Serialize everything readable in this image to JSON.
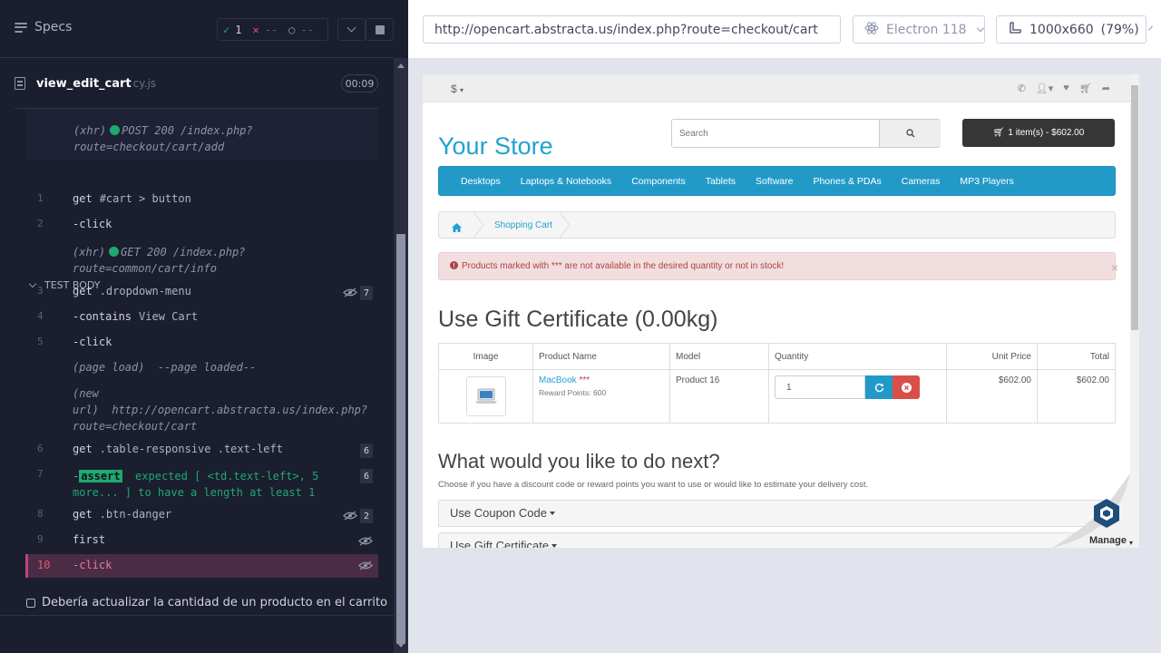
{
  "reporter": {
    "specs_label": "Specs",
    "stats": {
      "passed": "1",
      "failed": "--",
      "pending": "--"
    },
    "spec": {
      "name": "view_edit_cart",
      "ext": "cy.js",
      "duration": "00:09"
    },
    "prev_xhr": {
      "type": "(xhr)",
      "method": "POST 200 /index.php?",
      "route": "route=checkout/cart/add"
    },
    "section_title": "TEST BODY",
    "commands": [
      {
        "num": "1",
        "name": "get",
        "arg": "#cart > button"
      },
      {
        "num": "2",
        "name": "-click",
        "arg": ""
      },
      {
        "type": "(xhr)",
        "method": "GET 200 /index.php?",
        "route": "route=common/cart/info"
      },
      {
        "num": "3",
        "name": "get",
        "arg": ".dropdown-menu",
        "badge": "7"
      },
      {
        "num": "4",
        "name": "-contains",
        "arg": "View Cart"
      },
      {
        "num": "5",
        "name": "-click",
        "arg": ""
      },
      {
        "type": "(page load)",
        "text": "--page loaded--"
      },
      {
        "type": "(new url)",
        "text": "http://opencart.abstracta.us/index.php?route=checkout/cart"
      },
      {
        "num": "6",
        "name": "get",
        "arg": ".table-responsive .text-left",
        "badge": "6"
      },
      {
        "num": "7",
        "name": "-",
        "assert": "assert",
        "text": "expected [ <td.text-left>, 5 more... ] to have a length at least 1",
        "badge": "6"
      },
      {
        "num": "8",
        "name": "get",
        "arg": ".btn-danger",
        "badge": "2"
      },
      {
        "num": "9",
        "name": "first",
        "arg": ""
      },
      {
        "num": "10",
        "name": "-click",
        "arg": ""
      }
    ],
    "test_title": "Debería actualizar la cantidad de un producto en el carrito"
  },
  "aut": {
    "url": "http://opencart.abstracta.us/index.php?route=checkout/cart",
    "browser": "Electron 118",
    "viewport": "1000x660",
    "zoom": "(79%)"
  },
  "store": {
    "currency": "$",
    "logo": "Your Store",
    "search_placeholder": "Search",
    "cart_button": "1 item(s) - $602.00",
    "menu": [
      "Desktops",
      "Laptops & Notebooks",
      "Components",
      "Tablets",
      "Software",
      "Phones & PDAs",
      "Cameras",
      "MP3 Players"
    ],
    "breadcrumb": "Shopping Cart",
    "alert": "Products marked with *** are not available in the desired quantity or not in stock!",
    "cart_heading": "Use Gift Certificate  (0.00kg)",
    "table": {
      "headers": [
        "Image",
        "Product Name",
        "Model",
        "Quantity",
        "Unit Price",
        "Total"
      ],
      "row": {
        "product": "MacBook",
        "stars": "***",
        "reward": "Reward Points: 600",
        "model": "Product 16",
        "quantity": "1",
        "unit_price": "$602.00",
        "total": "$602.00"
      }
    },
    "next_heading": "What would you like to do next?",
    "next_desc": "Choose if you have a discount code or reward points you want to use or would like to estimate your delivery cost.",
    "accordion": [
      "Use Coupon Code",
      "Use Gift Certificate"
    ],
    "manage_label": "Manage"
  },
  "colors": {
    "accent": "#229ac8",
    "danger": "#da4f49",
    "pass": "#1fa971",
    "fail": "#e45770"
  }
}
